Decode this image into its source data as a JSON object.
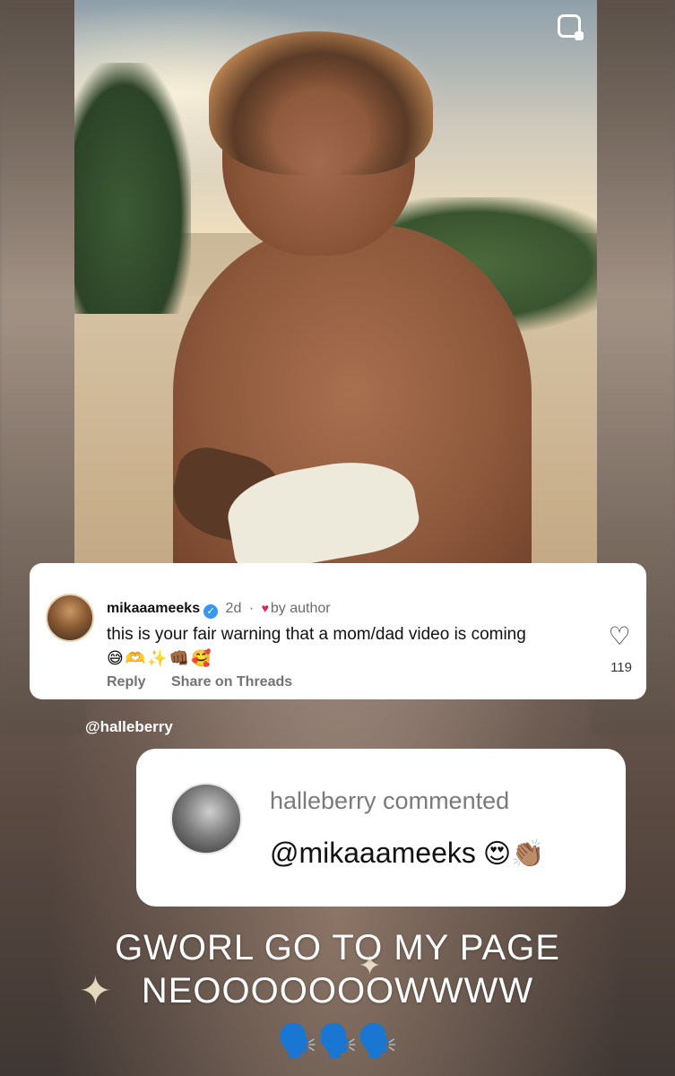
{
  "comment": {
    "username": "mikaaameeks",
    "time": "2d",
    "separator": "·",
    "liked_by": "by author",
    "text": "this is your fair warning that a mom/dad video is coming",
    "emoji": "😅🫶✨👊🏾🥰",
    "reply_label": "Reply",
    "share_label": "Share on Threads",
    "likes": "119"
  },
  "mention": "@halleberry",
  "reply_sticker": {
    "header": "halleberry commented",
    "text": "@mikaaameeks",
    "emoji": "😍👏🏽"
  },
  "caption": {
    "line1": "GWORL GO TO MY PAGE",
    "line2": "NEOOOOOOOWWWW",
    "emoji": "🗣️🗣️🗣️"
  },
  "icons": {
    "verified": "verified-badge-icon",
    "heart": "heart-icon",
    "save": "save-icon"
  },
  "colors": {
    "verified": "#3897f0",
    "liked_heart": "#e0245e"
  }
}
